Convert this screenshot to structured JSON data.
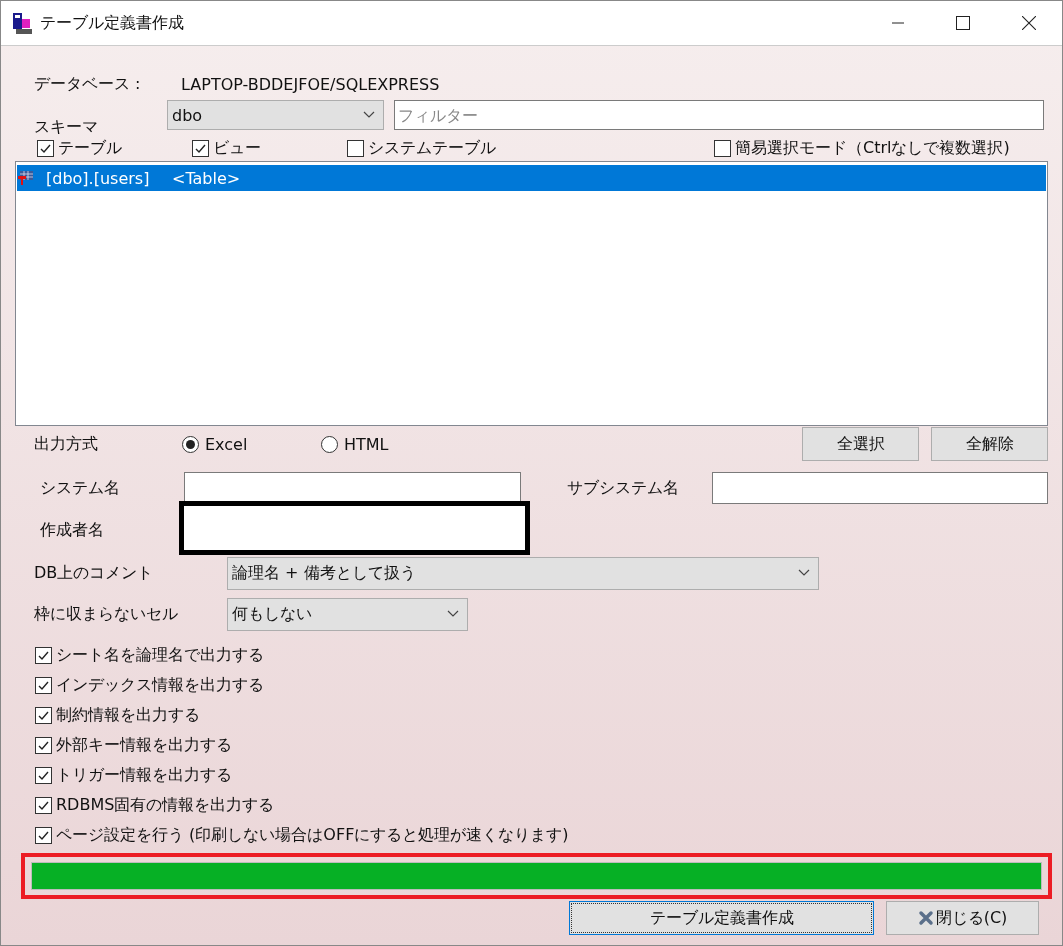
{
  "window": {
    "title": "テーブル定義書作成"
  },
  "database": {
    "label": "データベース :",
    "value": "LAPTOP-BDDEJFOE/SQLEXPRESS"
  },
  "schema": {
    "label": "スキーマ",
    "value": "dbo",
    "filter_placeholder": "フィルター"
  },
  "object_filters": [
    {
      "label": "テーブル",
      "checked": true
    },
    {
      "label": "ビュー",
      "checked": true
    },
    {
      "label": "システムテーブル",
      "checked": false
    }
  ],
  "easy_select": {
    "label": "簡易選択モード（Ctrlなしで複数選択)",
    "checked": false
  },
  "objects": [
    {
      "name": "[dbo].[users]",
      "type": "<Table>",
      "selected": true
    }
  ],
  "select_buttons": [
    "全選択",
    "全解除"
  ],
  "output": {
    "label": "出力方式",
    "options": [
      {
        "label": "Excel",
        "selected": true
      },
      {
        "label": "HTML",
        "selected": false
      }
    ]
  },
  "system_name": {
    "label": "システム名"
  },
  "subsystem_name": {
    "label": "サブシステム名"
  },
  "author": {
    "label": "作成者名",
    "highlighted": true
  },
  "db_comment": {
    "label": "DB上のコメント",
    "value": "論理名 + 備考として扱う"
  },
  "overflow_cell": {
    "label": "枠に収まらないセル",
    "value": "何もしない"
  },
  "options": [
    {
      "label": "シート名を論理名で出力する",
      "checked": true
    },
    {
      "label": "インデックス情報を出力する",
      "checked": true
    },
    {
      "label": "制約情報を出力する",
      "checked": true
    },
    {
      "label": "外部キー情報を出力する",
      "checked": true
    },
    {
      "label": "トリガー情報を出力する",
      "checked": true
    },
    {
      "label": "RDBMS固有の情報を出力する",
      "checked": true
    },
    {
      "label": "ページ設定を行う (印刷しない場合はOFFにすると処理が速くなります)",
      "checked": true
    }
  ],
  "progress": {
    "level": 1,
    "highlighted": true
  },
  "buttons": [
    {
      "label": "テーブル定義書作成",
      "kind": "primary"
    },
    {
      "label": "閉じる(C)",
      "kind": "close"
    }
  ]
}
